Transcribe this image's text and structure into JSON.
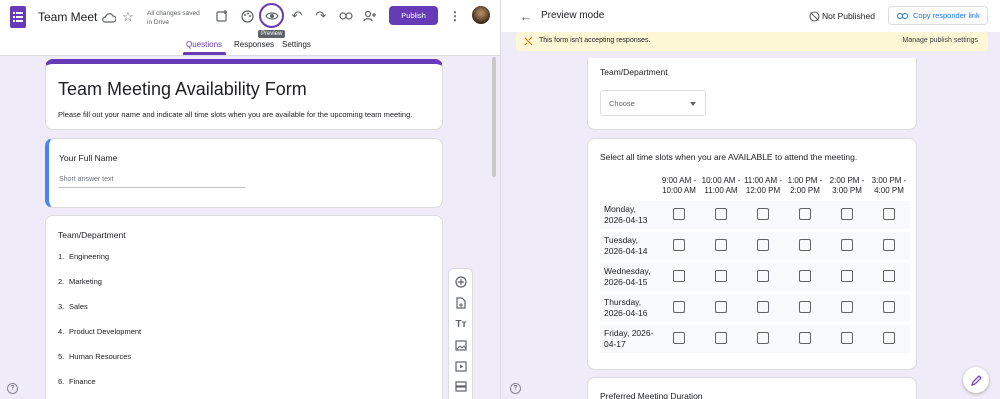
{
  "editor": {
    "title": "Team Meeting Availability",
    "save_status_line1": "All changes saved",
    "save_status_line2": "in Drive",
    "publish_label": "Publish",
    "preview_tooltip": "Preview",
    "tabs": [
      "Questions",
      "Responses",
      "Settings"
    ],
    "form_title": "Team Meeting Availability Form",
    "form_description": "Please fill out your name and indicate all time slots when you are available for the upcoming team meeting.",
    "q1_title": "Your Full Name",
    "q1_placeholder": "Short answer text",
    "q2_title": "Team/Department",
    "options": [
      {
        "num": "1.",
        "label": "Engineering"
      },
      {
        "num": "2.",
        "label": "Marketing"
      },
      {
        "num": "3.",
        "label": "Sales"
      },
      {
        "num": "4.",
        "label": "Product Development"
      },
      {
        "num": "5.",
        "label": "Human Resources"
      },
      {
        "num": "6.",
        "label": "Finance"
      }
    ],
    "colors": {
      "accent": "#673ab7",
      "active_tab": "#673ab7",
      "bg": "#f0ebf8",
      "focus_bar": "#4285f4"
    }
  },
  "preview": {
    "mode_label": "Preview mode",
    "status": "Not Published",
    "copy_link": "Copy responder link",
    "banner_text": "This form isn't accepting responses.",
    "banner_link": "Manage publish settings",
    "dept_title": "Team/Department",
    "dropdown_value": "Choose",
    "grid_title": "Select all time slots when you are AVAILABLE to attend the meeting.",
    "columns": [
      {
        "l1": "9:00 AM -",
        "l2": "10:00 AM"
      },
      {
        "l1": "10:00 AM -",
        "l2": "11:00 AM"
      },
      {
        "l1": "11:00 AM -",
        "l2": "12:00 PM"
      },
      {
        "l1": "1:00 PM -",
        "l2": "2:00 PM"
      },
      {
        "l1": "2:00 PM -",
        "l2": "3:00 PM"
      },
      {
        "l1": "3:00 PM -",
        "l2": "4:00 PM"
      }
    ],
    "rows": [
      {
        "l1": "Monday,",
        "l2": "2026-04-13"
      },
      {
        "l1": "Tuesday,",
        "l2": "2026-04-14"
      },
      {
        "l1": "Wednesday,",
        "l2": "2026-04-15"
      },
      {
        "l1": "Thursday,",
        "l2": "2026-04-16"
      },
      {
        "l1": "Friday, 2026-",
        "l2": "04-17"
      }
    ],
    "duration_title": "Preferred Meeting Duration"
  }
}
